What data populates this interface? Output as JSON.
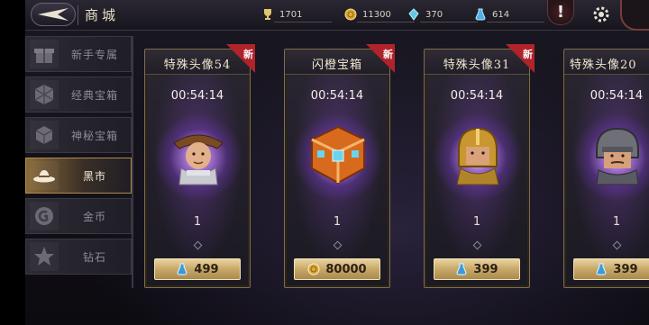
{
  "header": {
    "title": "商城",
    "resources": [
      {
        "icon": "trophy-icon",
        "value": "1701"
      },
      {
        "icon": "gold-coin-icon",
        "value": "11300"
      },
      {
        "icon": "gem-icon",
        "value": "370"
      },
      {
        "icon": "potion-icon",
        "value": "614"
      }
    ],
    "alert_label": "!"
  },
  "sidebar": {
    "items": [
      {
        "label": "新手专属",
        "icon": "gift-icon",
        "active": false
      },
      {
        "label": "经典宝箱",
        "icon": "chest-icon",
        "active": false
      },
      {
        "label": "神秘宝箱",
        "icon": "mystery-chest-icon",
        "active": false
      },
      {
        "label": "黑市",
        "icon": "hat-icon",
        "active": true
      },
      {
        "label": "金币",
        "icon": "coin-icon",
        "active": false
      },
      {
        "label": "钻石",
        "icon": "star-icon",
        "active": false
      }
    ]
  },
  "cards": [
    {
      "name": "特殊头像54",
      "badge": "新",
      "timer": "00:54:14",
      "count": "1",
      "price": "499",
      "currency": "potion-icon",
      "item": "hat-knight-portrait"
    },
    {
      "name": "闪橙宝箱",
      "badge": "新",
      "timer": "00:54:14",
      "count": "1",
      "price": "80000",
      "currency": "gold-coin-icon",
      "item": "orange-chest"
    },
    {
      "name": "特殊头像31",
      "badge": "新",
      "timer": "00:54:14",
      "count": "1",
      "price": "399",
      "currency": "potion-icon",
      "item": "golden-helm-portrait"
    },
    {
      "name": "特殊头像20",
      "badge": "",
      "timer": "00:54:14",
      "count": "1",
      "price": "399",
      "currency": "potion-icon",
      "item": "iron-helm-portrait"
    }
  ],
  "colors": {
    "accent": "#c7a867",
    "badge": "#b0232a",
    "active_tab": "#8a6a3b"
  }
}
